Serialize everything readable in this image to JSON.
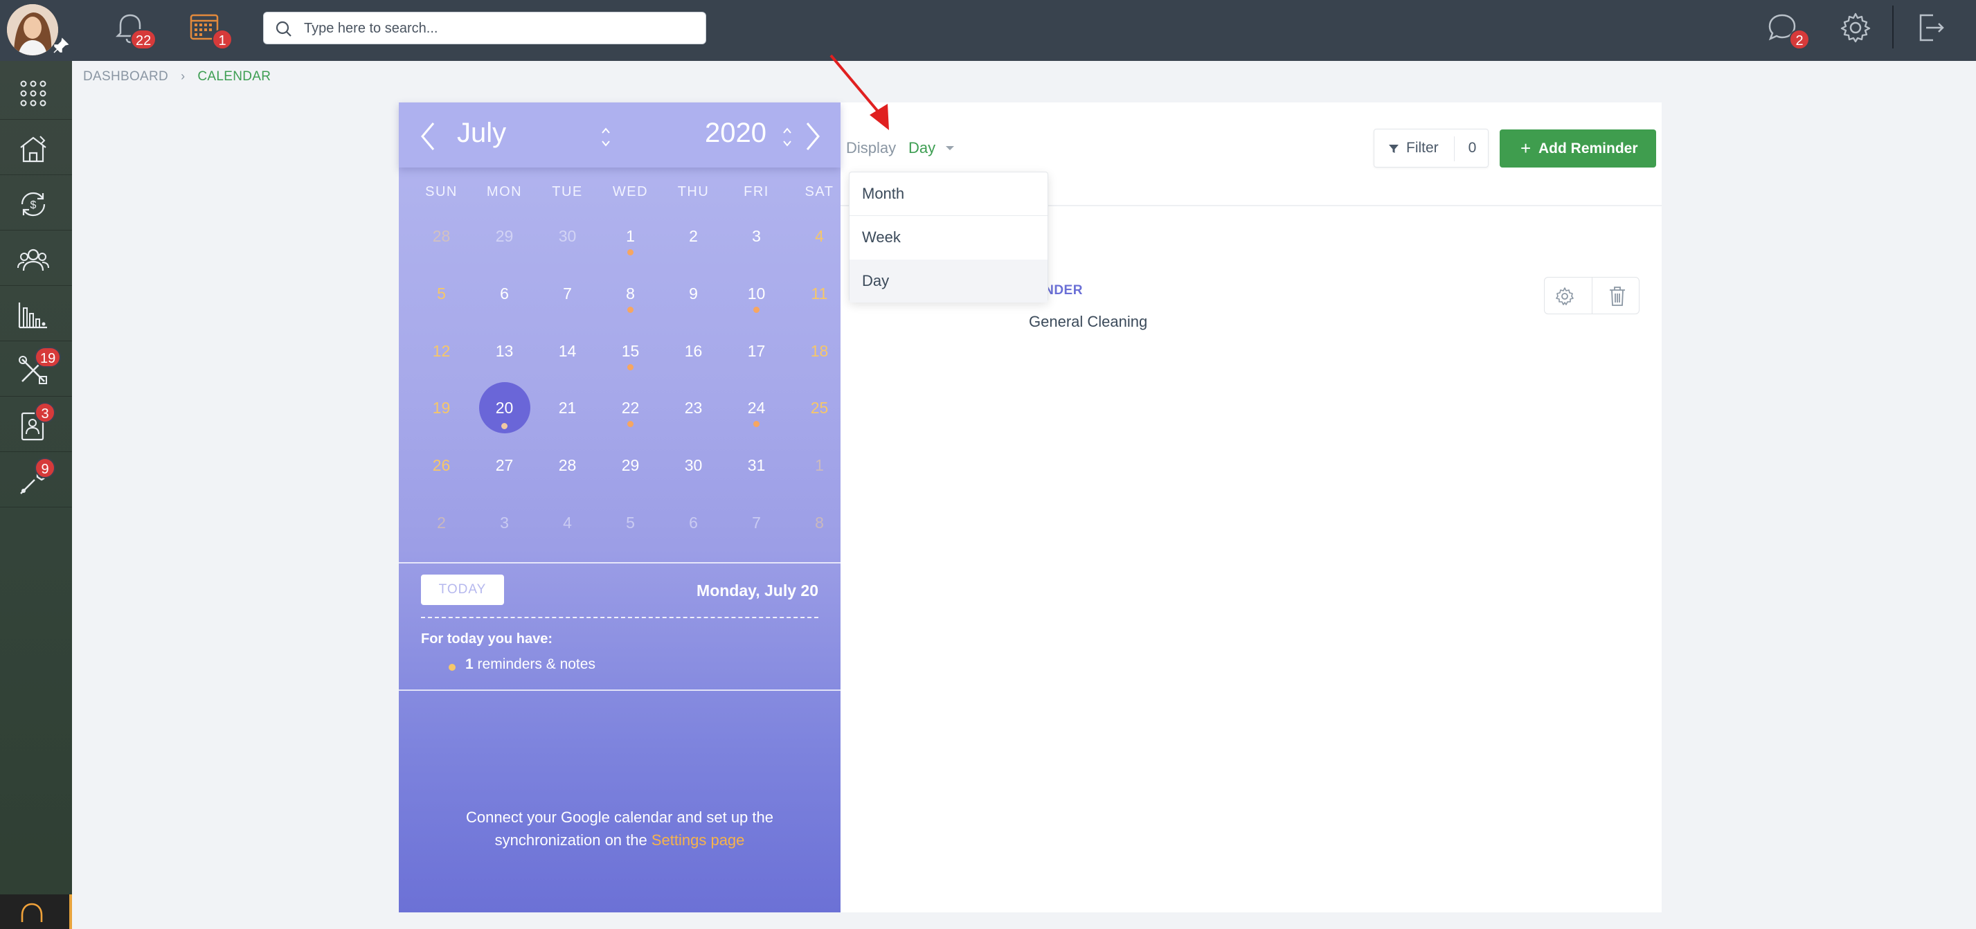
{
  "topbar": {
    "notifications_count": "22",
    "calendar_count": "1",
    "search_placeholder": "Type here to search...",
    "messages_count": "2"
  },
  "sidebar": {
    "items": [
      {
        "icon": "apps-grid-icon"
      },
      {
        "icon": "house-icon"
      },
      {
        "icon": "money-cycle-icon"
      },
      {
        "icon": "users-icon"
      },
      {
        "icon": "bar-chart-icon"
      },
      {
        "icon": "tools-icon",
        "badge": "19"
      },
      {
        "icon": "contact-card-icon",
        "badge": "3"
      },
      {
        "icon": "wrench-icon",
        "badge": "9"
      }
    ],
    "help_icon": "headset-icon"
  },
  "breadcrumb": {
    "dashboard": "DASHBOARD",
    "current": "CALENDAR"
  },
  "calendar": {
    "month": "July",
    "year": "2020",
    "weekdays": [
      "SUN",
      "MON",
      "TUE",
      "WED",
      "THU",
      "FRI",
      "SAT"
    ],
    "weeks": [
      [
        "28",
        "29",
        "30",
        "1",
        "2",
        "3",
        "4"
      ],
      [
        "5",
        "6",
        "7",
        "8",
        "9",
        "10",
        "11"
      ],
      [
        "12",
        "13",
        "14",
        "15",
        "16",
        "17",
        "18"
      ],
      [
        "19",
        "20",
        "21",
        "22",
        "23",
        "24",
        "25"
      ],
      [
        "26",
        "27",
        "28",
        "29",
        "30",
        "31",
        "1"
      ],
      [
        "2",
        "3",
        "4",
        "5",
        "6",
        "7",
        "8"
      ]
    ],
    "selected_day": "20",
    "days_with_events": [
      "1",
      "8",
      "10",
      "15",
      "20",
      "22",
      "24"
    ],
    "today_button": "TODAY",
    "full_date": "Monday, July 20",
    "for_today_label": "For today you have:",
    "reminders_count": "1",
    "reminders_label": "reminders & notes",
    "connect_text": "Connect your Google calendar and set up the synchronization on the",
    "connect_link": "Settings page"
  },
  "display": {
    "label": "Display",
    "value": "Day",
    "options": [
      "Month",
      "Week",
      "Day"
    ],
    "selected": "Day"
  },
  "filter": {
    "label": "Filter",
    "count": "0"
  },
  "add_reminder_label": "Add Reminder",
  "reminder": {
    "type_label": "MINDER",
    "title": "General Cleaning"
  },
  "colors": {
    "accent_green": "#3f9d4e",
    "calendar_purple": "#9c9ee6",
    "badge_red": "#d63a3a",
    "weekend_yellow": "#f6c769"
  }
}
